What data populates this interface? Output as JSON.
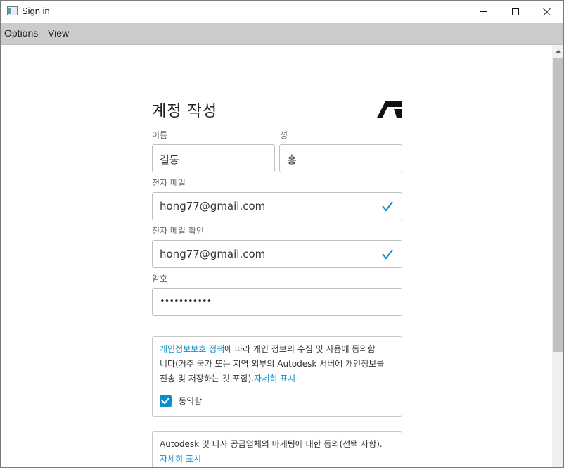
{
  "window": {
    "title": "Sign in"
  },
  "menu": {
    "items": [
      "Options",
      "View"
    ]
  },
  "form": {
    "title": "계정 작성",
    "first_name": {
      "label": "이름",
      "value": "길동"
    },
    "last_name": {
      "label": "성",
      "value": "홍"
    },
    "email": {
      "label": "전자 메일",
      "value": "hong77@gmail.com",
      "icon": "check-icon"
    },
    "email_confirm": {
      "label": "전자 메일 확인",
      "value": "hong77@gmail.com",
      "icon": "check-icon"
    },
    "password": {
      "label": "암호",
      "value": "•••••••••••"
    }
  },
  "privacy": {
    "link_text": "개인정보보호 정책",
    "text_line1": "에 따라 개인 정보의 수집 및 사용에 동의합",
    "text_line2": "니다(거주 국가 또는 지역 외부의 Autodesk 서버에 개인정보를",
    "text_line3": "전송 및 저장하는 것 포함).",
    "details_link": "자세히 표시",
    "checkbox_label": "동의함",
    "checked": true
  },
  "marketing": {
    "text": "Autodesk 및 타사 공급업체의 마케팅에 대한 동의(선택 사항).",
    "details_link": "자세히 표시"
  },
  "colors": {
    "accent": "#0c8dd0",
    "link": "#0b8fc4",
    "menubar": "#cbcbcb"
  }
}
